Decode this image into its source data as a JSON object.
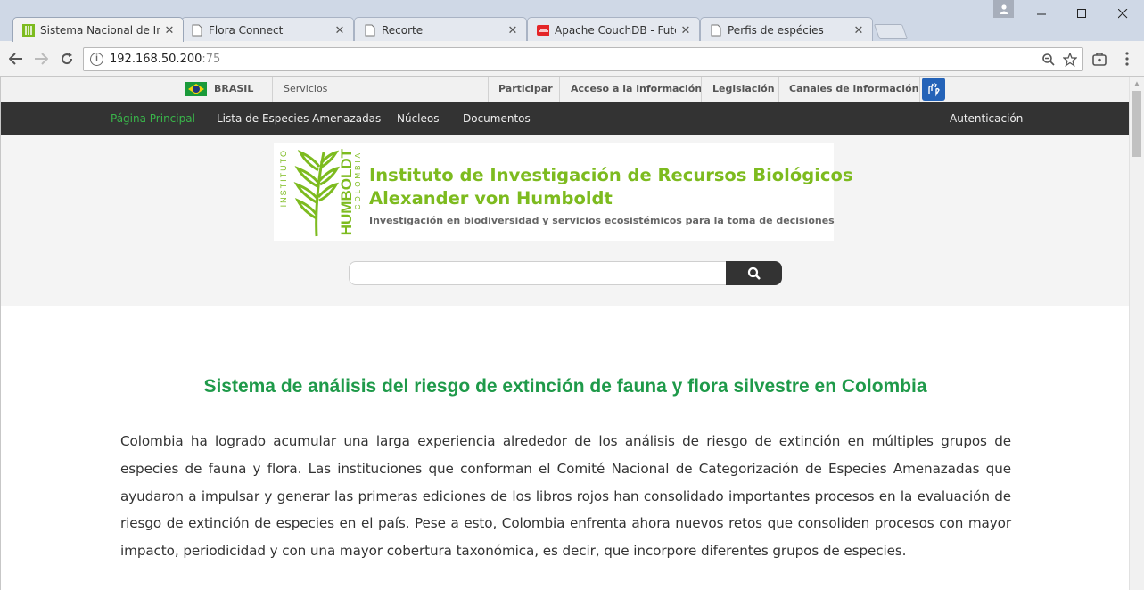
{
  "browser": {
    "tabs": [
      {
        "title": "Sistema Nacional de Info",
        "active": true,
        "favicon": "humboldt-icon"
      },
      {
        "title": "Flora Connect",
        "active": false,
        "favicon": "page-icon"
      },
      {
        "title": "Recorte",
        "active": false,
        "favicon": "page-icon"
      },
      {
        "title": "Apache CouchDB - Futor",
        "active": false,
        "favicon": "couchdb-icon"
      },
      {
        "title": "Perfis de espécies",
        "active": false,
        "favicon": "page-icon"
      }
    ],
    "url_host": "192.168.50.200",
    "url_port": ":75"
  },
  "govbar": {
    "country": "BRASIL",
    "links_left": [
      "Servicios"
    ],
    "links_right": [
      "Participar",
      "Acceso a la información",
      "Legislación",
      "Canales de información"
    ]
  },
  "menu": {
    "items": [
      "Página Principal",
      "Lista de Especies Amenazadas",
      "Núcleos",
      "Documentos"
    ],
    "auth": "Autenticación",
    "accent_color": "#39b54a"
  },
  "banner": {
    "logo_main": "HUMBOLDT",
    "logo_top": "INSTITUTO",
    "logo_bottom": "COLOMBIA",
    "title_line1": "Instituto de Investigación de Recursos Biológicos",
    "title_line2": "Alexander von Humboldt",
    "subtitle": "Investigación en biodiversidad y servicios ecosistémicos para la toma de decisiones",
    "brand_color": "#7dbb1f"
  },
  "search": {
    "placeholder": ""
  },
  "content": {
    "title": "Sistema de análisis del riesgo de extinción de fauna y flora silvestre en Colombia",
    "paragraph": "Colombia ha logrado acumular una larga experiencia alrededor de los análisis de riesgo de extinción en múltiples grupos de especies de fauna y flora. Las instituciones que conforman el Comité Nacional de Categorización de Especies Amenazadas que ayudaron a impulsar y generar las primeras ediciones de los libros rojos han consolidado importantes procesos en la evaluación de riesgo de extinción de especies en el país. Pese a esto, Colombia enfrenta ahora nuevos retos que consoliden procesos con mayor impacto, periodicidad y con una mayor cobertura taxonómica, es decir, que incorpore diferentes grupos de especies.",
    "title_color": "#1f9a4a"
  }
}
